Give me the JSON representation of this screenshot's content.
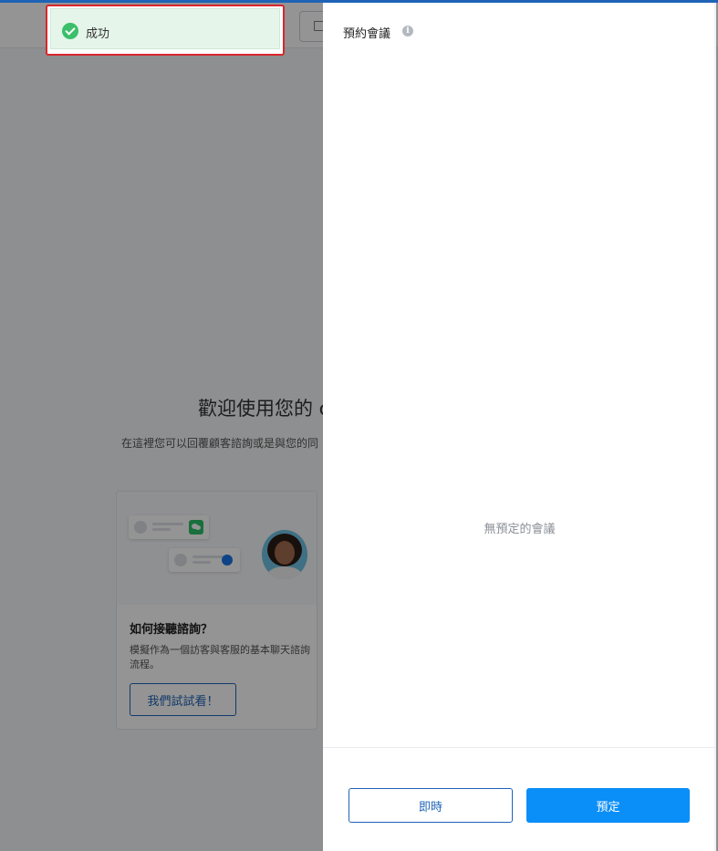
{
  "header": {
    "button_label": "□"
  },
  "toast": {
    "message": "成功",
    "icon": "check-circle-icon"
  },
  "welcome": {
    "title": "歡迎使用您的 c",
    "subtitle": "在這裡您可以回覆顧客諮詢或是與您的同"
  },
  "card": {
    "title": "如何接聽諮詢？",
    "description": "模擬作為一個訪客與客服的基本聊天諮詢流程。",
    "button_label": "我們試試看！"
  },
  "panel": {
    "title": "預約會議",
    "info_icon": "i",
    "empty_text": "無預定的會議",
    "buttons": {
      "now": "即時",
      "book": "預定"
    }
  },
  "colors": {
    "accent": "#1f63b6",
    "primary_button": "#0a8ef8",
    "success": "#3bbf6a",
    "toast_border": "#d9262c"
  }
}
